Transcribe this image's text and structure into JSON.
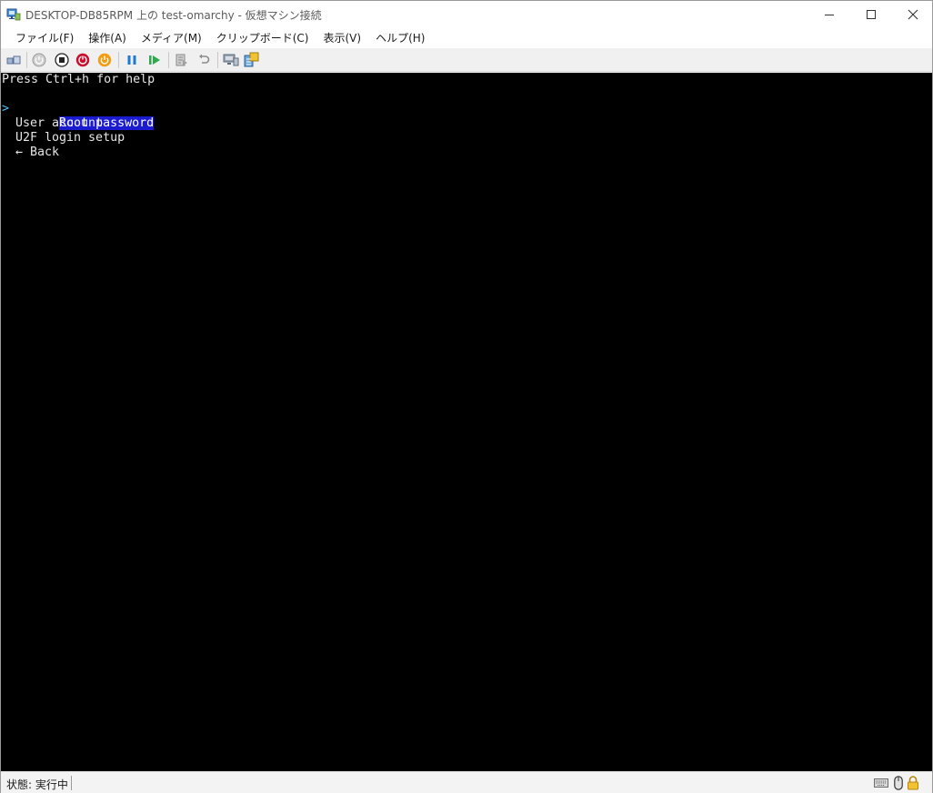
{
  "window": {
    "title": "DESKTOP-DB85RPM 上の test-omarchy  - 仮想マシン接続",
    "icon": "vm-connection-icon"
  },
  "menu": {
    "items": [
      "ファイル(F)",
      "操作(A)",
      "メディア(M)",
      "クリップボード(C)",
      "表示(V)",
      "ヘルプ(H)"
    ]
  },
  "toolbar": {
    "icons": [
      "ctrl-alt-del-icon",
      "start-icon",
      "turn-off-icon",
      "shutdown-icon",
      "save-icon",
      "pause-icon",
      "resume-icon",
      "checkpoint-icon",
      "revert-icon",
      "enhanced-session-icon",
      "share-icon"
    ]
  },
  "console": {
    "help_line": "Press Ctrl+h for help",
    "pointer": ">",
    "options": [
      {
        "label": "Root password",
        "selected": true
      },
      {
        "label": "User account",
        "selected": false
      },
      {
        "label": "U2F login setup",
        "selected": false
      },
      {
        "label": "← Back",
        "selected": false
      }
    ]
  },
  "status": {
    "text": "状態: 実行中",
    "icons": [
      "keyboard-icon",
      "mouse-icon",
      "lock-icon"
    ]
  },
  "colors": {
    "selection_bg": "#1b1bd0",
    "pointer": "#4fc3f7",
    "console_bg": "#000000"
  }
}
